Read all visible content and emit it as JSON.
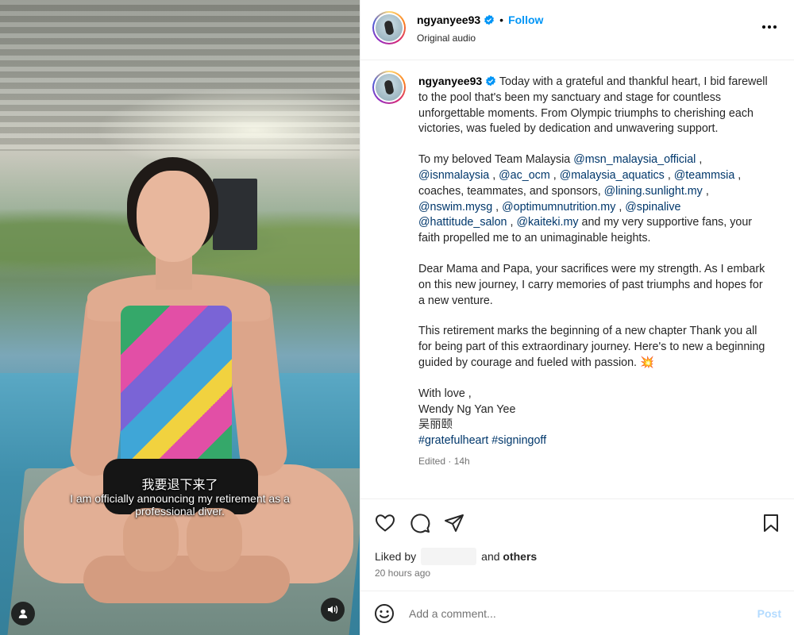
{
  "post": {
    "username": "ngyanyee93",
    "follow_label": "Follow",
    "separator": "•",
    "audio_label": "Original audio"
  },
  "video": {
    "subtitle_zh": "我要退下来了",
    "subtitle_en": "I am officially announcing my retirement as a professional diver."
  },
  "caption": {
    "username": "ngyanyee93",
    "p1": "Today with a grateful and thankful heart, I bid farewell to the pool that's been my sanctuary and stage for countless unforgettable moments. From Olympic triumphs to cherishing each victories, was fueled by dedication and unwavering support.",
    "p2_intro": "To my beloved Team Malaysia",
    "p2_coaches": ", coaches, teammates, and sponsors,",
    "p2_fans": "and my very supportive fans, your faith propelled me to an unimaginable heights.",
    "sep": ",",
    "mentions": [
      "@msn_malaysia_official",
      "@isnmalaysia",
      "@ac_ocm",
      "@malaysia_aquatics",
      "@teammsia",
      "@lining.sunlight.my",
      "@nswim.mysg",
      "@optimumnutrition.my",
      "@spinalive",
      "@hattitude_salon",
      "@kaiteki.my"
    ],
    "p3": "Dear Mama and Papa, your sacrifices were my strength. As I embark on this new journey, I carry memories of past triumphs and hopes for a new venture.",
    "p4": "This retirement marks the beginning of a new chapter Thank you all for being part of this extraordinary journey. Here's to new a beginning guided by courage and fueled with passion.",
    "sparkle": "💥",
    "sign_off": "With love ,",
    "name_en": "Wendy Ng Yan Yee",
    "name_zh": "吴丽颐",
    "hashtags": [
      "#gratefulheart",
      "#signingoff"
    ],
    "edited": "Edited · 14h"
  },
  "engagement": {
    "liked_by": "Liked by",
    "and": "and",
    "others": "others",
    "time_ago": "20 hours ago"
  },
  "comment": {
    "placeholder": "Add a comment...",
    "post_label": "Post"
  },
  "icons": {
    "verified": "verified-badge-icon",
    "more": "more-options-icon",
    "like": "heart-icon",
    "comment": "comment-bubble-icon",
    "share": "send-icon",
    "save": "bookmark-icon",
    "emoji": "emoji-smile-icon",
    "user": "user-tag-icon",
    "sound": "speaker-icon"
  },
  "colors": {
    "link": "#0095f6",
    "mention": "#00376b",
    "muted": "#737373",
    "post_disabled": "#b3dbff"
  }
}
